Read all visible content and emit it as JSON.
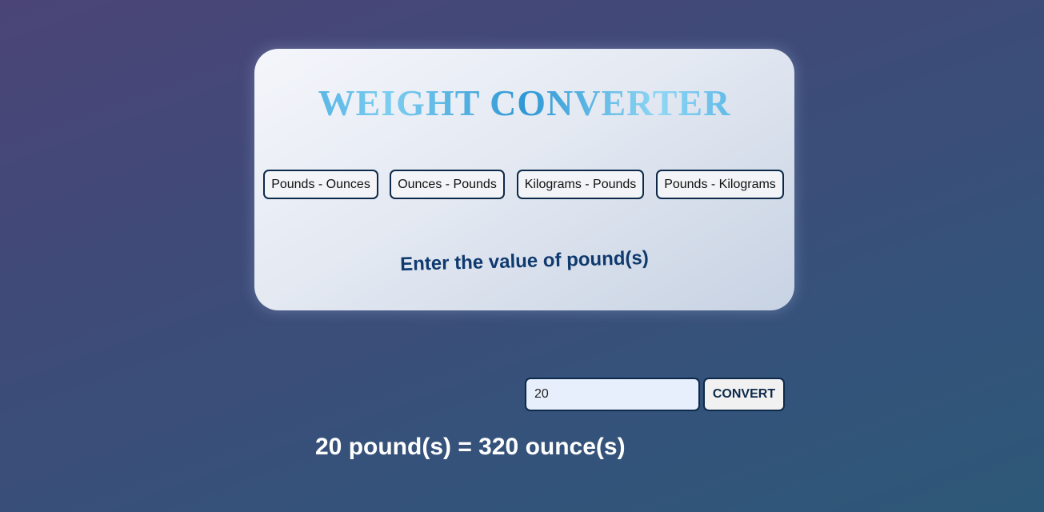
{
  "card": {
    "title": "WEIGHT CONVERTER",
    "modes": [
      {
        "label": "Pounds - Ounces"
      },
      {
        "label": "Ounces - Pounds"
      },
      {
        "label": "Kilograms - Pounds"
      },
      {
        "label": "Pounds - Kilograms"
      }
    ],
    "prompt": "Enter the value of pound(s)"
  },
  "form": {
    "input_value": "20",
    "convert_label": "CONVERT"
  },
  "result": {
    "text": "20 pound(s) = 320 ounce(s)"
  },
  "colors": {
    "title_gradient": "#4eb0e0",
    "button_border": "#0d2a4a",
    "prompt_text": "#0f3a6e",
    "result_text": "#ffffff"
  }
}
